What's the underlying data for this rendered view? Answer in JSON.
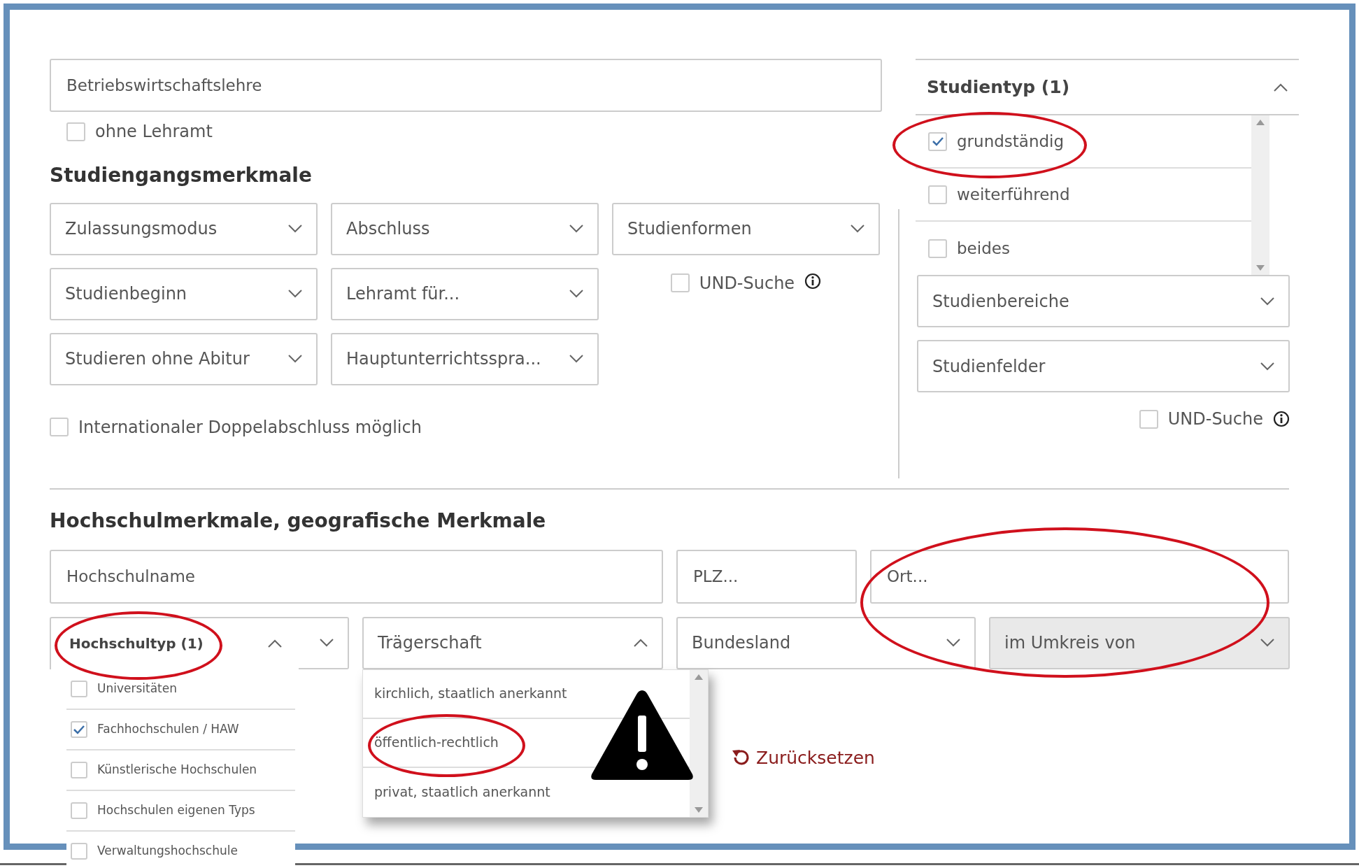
{
  "search": {
    "value": "Betriebswirtschaftslehre"
  },
  "ohne_lehramt": {
    "label": "ohne Lehramt",
    "checked": false
  },
  "studiengang": {
    "heading": "Studiengangsmerkmale",
    "selects": [
      {
        "label": "Zulassungsmodus"
      },
      {
        "label": "Abschluss"
      },
      {
        "label": "Studienformen"
      },
      {
        "label": "Studienbeginn"
      },
      {
        "label": "Lehramt für..."
      },
      {
        "label": "Studieren ohne Abitur"
      },
      {
        "label": "Hauptunterrichtsspra..."
      }
    ],
    "und_suche": {
      "label": "UND-Suche",
      "checked": false
    },
    "doppelabschluss": {
      "label": "Internationaler Doppelabschluss möglich",
      "checked": false
    }
  },
  "studientyp": {
    "title": "Studientyp (1)",
    "expanded": true,
    "options": [
      {
        "label": "grundständig",
        "checked": true,
        "circled": true
      },
      {
        "label": "weiterführend",
        "checked": false,
        "circled": false
      },
      {
        "label": "beides",
        "checked": false,
        "circled": false
      }
    ]
  },
  "right_selects": [
    {
      "label": "Studienbereiche"
    },
    {
      "label": "Studienfelder"
    }
  ],
  "right_und_suche": {
    "label": "UND-Suche",
    "checked": false
  },
  "hochschul": {
    "heading": "Hochschulmerkmale, geografische Merkmale",
    "fields": [
      {
        "placeholder": "Hochschulname",
        "circled": false
      },
      {
        "placeholder": "PLZ...",
        "circled": false
      },
      {
        "placeholder": "Ort...",
        "circled": true
      }
    ],
    "selects": [
      {
        "kind": "checklist",
        "label": "Hochschultyp (1)",
        "expanded": true,
        "circled": true,
        "warning": false,
        "disabled": false,
        "options": [
          {
            "label": "Universitäten",
            "checked": false,
            "circled": false
          },
          {
            "label": "Fachhochschulen / HAW",
            "checked": true,
            "circled": false
          },
          {
            "label": "Künstlerische Hochschulen",
            "checked": false,
            "circled": false
          },
          {
            "label": "Hochschulen eigenen Typs",
            "checked": false,
            "circled": false
          },
          {
            "label": "Verwaltungshochschule",
            "checked": false,
            "circled": false
          }
        ]
      },
      {
        "kind": "list",
        "label": "Trägerschaft",
        "expanded": true,
        "circled": false,
        "warning": true,
        "disabled": false,
        "options": [
          {
            "label": "kirchlich, staatlich anerkannt",
            "circled": false
          },
          {
            "label": "öffentlich-rechtlich",
            "circled": true
          },
          {
            "label": "privat, staatlich anerkannt",
            "circled": false
          }
        ]
      },
      {
        "kind": "list",
        "label": "Bundesland",
        "expanded": false,
        "circled": false,
        "warning": false,
        "disabled": false
      },
      {
        "kind": "list",
        "label": "im Umkreis von",
        "expanded": false,
        "circled": false,
        "warning": false,
        "disabled": true
      }
    ]
  },
  "reset": {
    "label": "Zurücksetzen"
  }
}
